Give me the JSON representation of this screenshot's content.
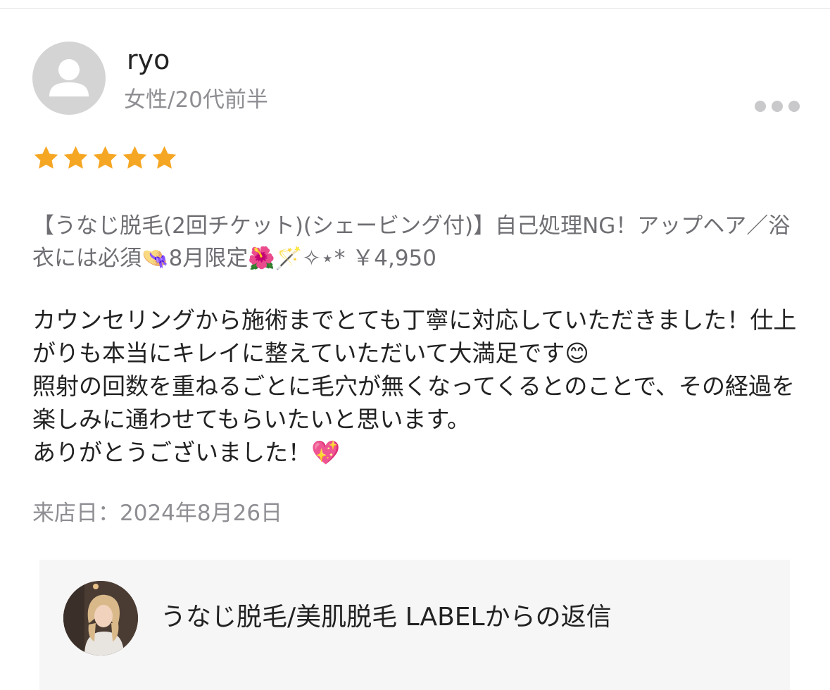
{
  "review": {
    "user_name": "ryo",
    "user_meta": "女性/20代前半",
    "rating": 5,
    "rating_max": 5,
    "star_color": "#f5a623",
    "menu": "【うなじ脱毛(2回チケット)(シェービング付)】自己処理NG！アップヘア／浴衣には必須👒8月限定🌺🪄✧⋆* ￥4,950",
    "body": "カウンセリングから施術までとても丁寧に対応していただきました！仕上がりも本当にキレイに整えていただいて大満足です😊\n照射の回数を重ねるごとに毛穴が無くなってくるとのことで、その経過を楽しみに通わせてもらいたいと思います。\nありがとうございました！💖",
    "visit_date": "来店日：2024年8月26日"
  },
  "reply": {
    "title": "うなじ脱毛/美肌脱毛 LABELからの返信"
  },
  "icons": {
    "avatar": "user-silhouette-icon",
    "more": "more-dots-icon",
    "star": "star-icon"
  }
}
